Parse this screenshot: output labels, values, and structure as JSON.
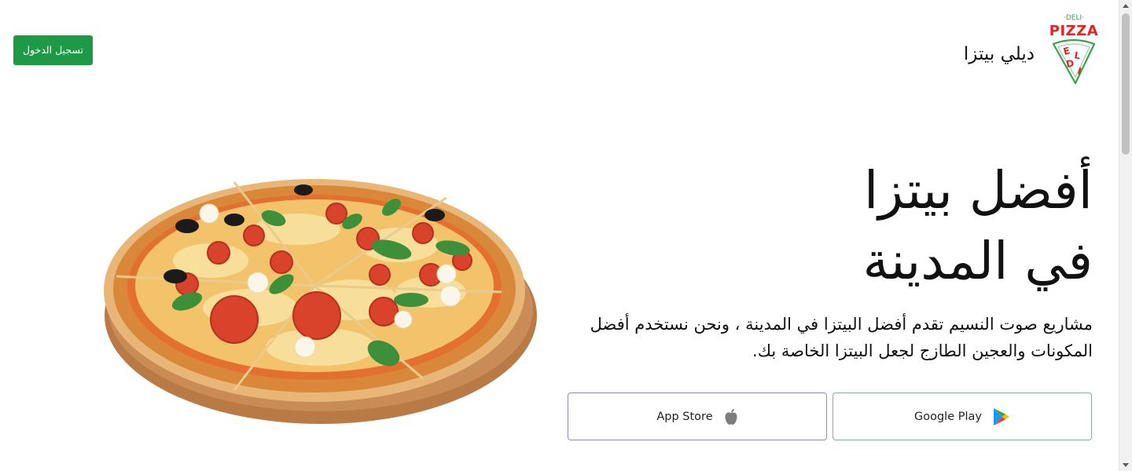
{
  "header": {
    "login_label": "تسجيل الدخول",
    "brand_name": "ديلي بيتزا",
    "logo": {
      "top_text": "·DELI·",
      "main_text": "PIZZA",
      "slice_letters": [
        "E",
        "L",
        "D",
        "I"
      ],
      "colors": {
        "red": "#e02424",
        "green": "#3aa14a"
      }
    }
  },
  "hero": {
    "title_line1": "أفضل بيتزا",
    "title_line2": "في المدينة",
    "description": "مشاريع صوت النسيم تقدم أفضل البيتزا في المدينة ، ونحن نستخدم أفضل المكونات والعجين الطازج لجعل البيتزا الخاصة بك."
  },
  "store_buttons": {
    "google_play": {
      "label": "Google Play",
      "icon": "google-play-icon"
    },
    "app_store": {
      "label": "App Store",
      "icon": "apple-icon"
    }
  },
  "colors": {
    "accent_green": "#1e9a47",
    "text": "#111111",
    "background": "#ffffff"
  },
  "image": {
    "pizza": "pizza-image"
  }
}
